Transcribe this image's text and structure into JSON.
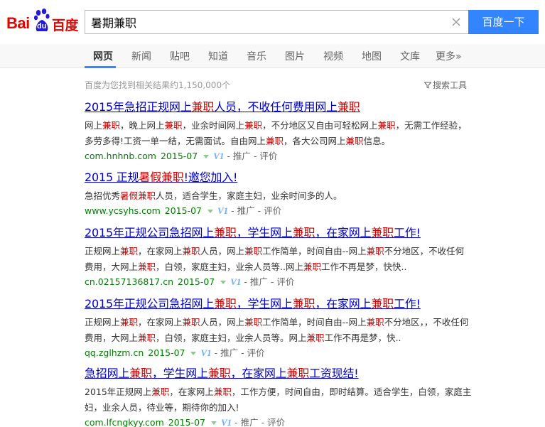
{
  "logo": {
    "bai": "Bai",
    "du": "du",
    "cn": "百度"
  },
  "search": {
    "query": "暑期兼职",
    "button_label": "百度一下"
  },
  "tabs": [
    {
      "label": "网页",
      "active": true
    },
    {
      "label": "新闻"
    },
    {
      "label": "贴吧"
    },
    {
      "label": "知道"
    },
    {
      "label": "音乐"
    },
    {
      "label": "图片"
    },
    {
      "label": "视频"
    },
    {
      "label": "地图"
    },
    {
      "label": "文库"
    },
    {
      "label": "更多»"
    }
  ],
  "stats": "百度为您找到相关结果约1,150,000个",
  "tools_label": "搜索工具",
  "results": [
    {
      "title": [
        [
          "2015年急招正规网上",
          0
        ],
        [
          "兼职",
          1
        ],
        [
          "人员，不收任何费用网上",
          0
        ],
        [
          "兼职",
          1
        ]
      ],
      "abstract": [
        [
          "网上",
          0
        ],
        [
          "兼职",
          1
        ],
        [
          "，晚上网上",
          0
        ],
        [
          "兼职",
          1
        ],
        [
          "，业余时间网上",
          0
        ],
        [
          "兼职",
          1
        ],
        [
          "，不分地区又自由可轻松网上",
          0
        ],
        [
          "兼职",
          1
        ],
        [
          "，无需工作经验，多劳多得!工资一单一结，无需面试。自由网上",
          0
        ],
        [
          "兼职",
          1
        ],
        [
          "，各大公司网上",
          0
        ],
        [
          "兼职",
          1
        ],
        [
          "信息。",
          0
        ]
      ],
      "url": "com.hnhnb.com",
      "date": "2015-07"
    },
    {
      "title": [
        [
          "2015 正规",
          0
        ],
        [
          "暑假兼职",
          1
        ],
        [
          "!邀您加入!",
          0
        ]
      ],
      "abstract": [
        [
          "急招优秀",
          0
        ],
        [
          "暑假兼职",
          1
        ],
        [
          "人员，适合学生，家庭主妇，业余时间多的人。",
          0
        ]
      ],
      "url": "www.ycsyhs.com",
      "date": "2015-07"
    },
    {
      "title": [
        [
          "2015年正规公司急招网上",
          0
        ],
        [
          "兼职",
          1
        ],
        [
          "，学生网上",
          0
        ],
        [
          "兼职",
          1
        ],
        [
          "，在家网上",
          0
        ],
        [
          "兼职",
          1
        ],
        [
          "工作!",
          0
        ]
      ],
      "abstract": [
        [
          "正规网上",
          0
        ],
        [
          "兼职",
          1
        ],
        [
          "，在家网上",
          0
        ],
        [
          "兼职",
          1
        ],
        [
          "人员，网上",
          0
        ],
        [
          "兼职",
          1
        ],
        [
          "工作简单，时间自由--网上",
          0
        ],
        [
          "兼职",
          1
        ],
        [
          "不分地区，不收任何费用，大网上",
          0
        ],
        [
          "兼职",
          1
        ],
        [
          "，白领，家庭主妇，业余人员等..网上",
          0
        ],
        [
          "兼职",
          1
        ],
        [
          "工作不再是梦，快快..",
          0
        ]
      ],
      "url": "cn.02157136817.cn",
      "date": "2015-07"
    },
    {
      "title": [
        [
          "2015年正规公司急招网上",
          0
        ],
        [
          "兼职",
          1
        ],
        [
          "，学生网上",
          0
        ],
        [
          "兼职",
          1
        ],
        [
          "，在家网上",
          0
        ],
        [
          "兼职",
          1
        ],
        [
          "工作!",
          0
        ]
      ],
      "abstract": [
        [
          "正规网上",
          0
        ],
        [
          "兼职",
          1
        ],
        [
          "，在家网上",
          0
        ],
        [
          "兼职",
          1
        ],
        [
          "人员，网上",
          0
        ],
        [
          "兼职",
          1
        ],
        [
          "工作简单，时间自由--网上",
          0
        ],
        [
          "兼职",
          1
        ],
        [
          "不分地区，，不收任何费用，大网上",
          0
        ],
        [
          "兼职",
          1
        ],
        [
          "，白领，家庭主妇，业余人员等。网上",
          0
        ],
        [
          "兼职",
          1
        ],
        [
          "工作不再是梦，快..",
          0
        ]
      ],
      "url": "qq.zglhzm.cn",
      "date": "2015-07"
    },
    {
      "title": [
        [
          "急招网上",
          0
        ],
        [
          "兼职",
          1
        ],
        [
          "，学生网上",
          0
        ],
        [
          "兼职",
          1
        ],
        [
          "，在家网上",
          0
        ],
        [
          "兼职",
          1
        ],
        [
          "工资现结!",
          0
        ]
      ],
      "abstract": [
        [
          "2015年正规网上",
          0
        ],
        [
          "兼职",
          1
        ],
        [
          "，在家网上",
          0
        ],
        [
          "兼职",
          1
        ],
        [
          "，工作方便，时间自由，即时结算。适合学生，白领，家庭主妇，业余人员，待业等，期待你的加入!",
          0
        ]
      ],
      "url": "com.lfcngkyy.com",
      "date": "2015-07"
    }
  ],
  "result_meta": {
    "v1": "V1",
    "ad": "推广",
    "eval": "评价",
    "sep": " - "
  },
  "colors": {
    "brand_red": "#e10602",
    "brand_blue": "#2319dc",
    "button_blue": "#3385ff",
    "link": "#0000cc",
    "highlight": "#cc0000",
    "url_green": "#008000"
  }
}
